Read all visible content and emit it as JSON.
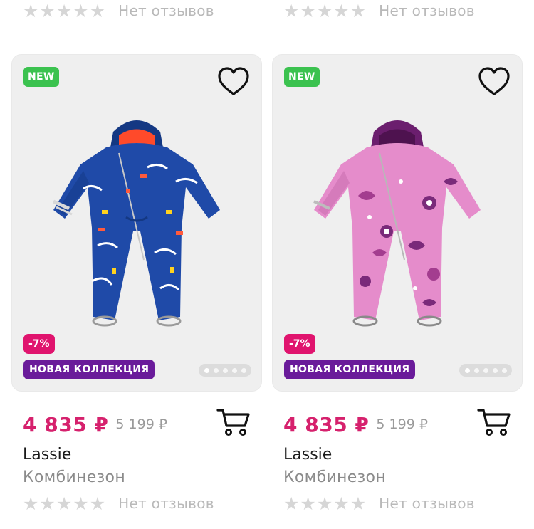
{
  "top_row": [
    {
      "stars": 5,
      "reviews_text": "Нет отзывов"
    },
    {
      "stars": 5,
      "reviews_text": "Нет отзывов"
    }
  ],
  "products": [
    {
      "badge_new": "NEW",
      "discount": "-7%",
      "collection": "НОВАЯ КОЛЛЕКЦИЯ",
      "price": "4 835 ₽",
      "old_price": "5 199 ₽",
      "brand": "Lassie",
      "type": "Комбинезон",
      "reviews_text": "Нет отзывов",
      "stars": 5,
      "image_count": 5,
      "active_image": 1,
      "colors": {
        "body": "#1f4aa8",
        "dark": "#143883",
        "lining": "#ff4a2a",
        "pattern1": "#ffffff",
        "pattern2": "#ffd21e",
        "pattern3": "#ff5a3c"
      }
    },
    {
      "badge_new": "NEW",
      "discount": "-7%",
      "collection": "НОВАЯ КОЛЛЕКЦИЯ",
      "price": "4 835 ₽",
      "old_price": "5 199 ₽",
      "brand": "Lassie",
      "type": "Комбинезон",
      "reviews_text": "Нет отзывов",
      "stars": 5,
      "image_count": 5,
      "active_image": 1,
      "colors": {
        "body": "#e58ccb",
        "dark": "#c56aab",
        "lining": "#6b1e6e",
        "pattern1": "#7a2a7a",
        "pattern2": "#ffffff",
        "pattern3": "#a33d8f"
      }
    }
  ],
  "colors": {
    "new_badge": "#3bc24f",
    "discount_badge": "#e0146e",
    "collection_badge": "#6a1b9a",
    "price": "#d6216d"
  }
}
